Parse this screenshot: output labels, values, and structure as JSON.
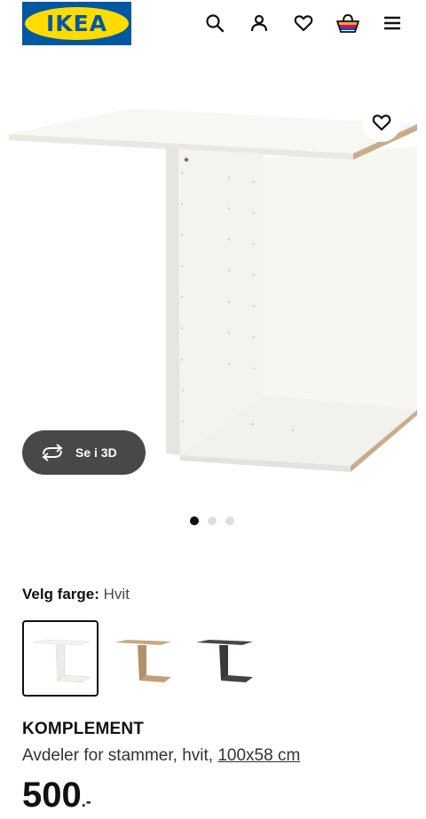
{
  "header": {
    "logo_text": "IKEA",
    "icons": [
      "search-icon",
      "user-icon",
      "heart-icon",
      "basket-icon",
      "menu-icon"
    ]
  },
  "hero": {
    "view_3d_label": "Se i 3D",
    "carousel": {
      "total": 3,
      "active": 1
    }
  },
  "color_picker": {
    "label": "Velg farge:",
    "selected_value": "Hvit",
    "swatches": [
      "Hvit",
      "Hvitbeiset eikemønstret",
      "Mørk grå"
    ]
  },
  "product": {
    "name": "KOMPLEMENT",
    "description": "Avdeler for stammer, hvit, ",
    "dimension_link": "100x58 cm",
    "price_main": "500",
    "price_suffix": ".-"
  },
  "colors": {
    "brand_blue": "#0058a3",
    "brand_yellow": "#ffdb00",
    "button_dark": "#484848"
  }
}
